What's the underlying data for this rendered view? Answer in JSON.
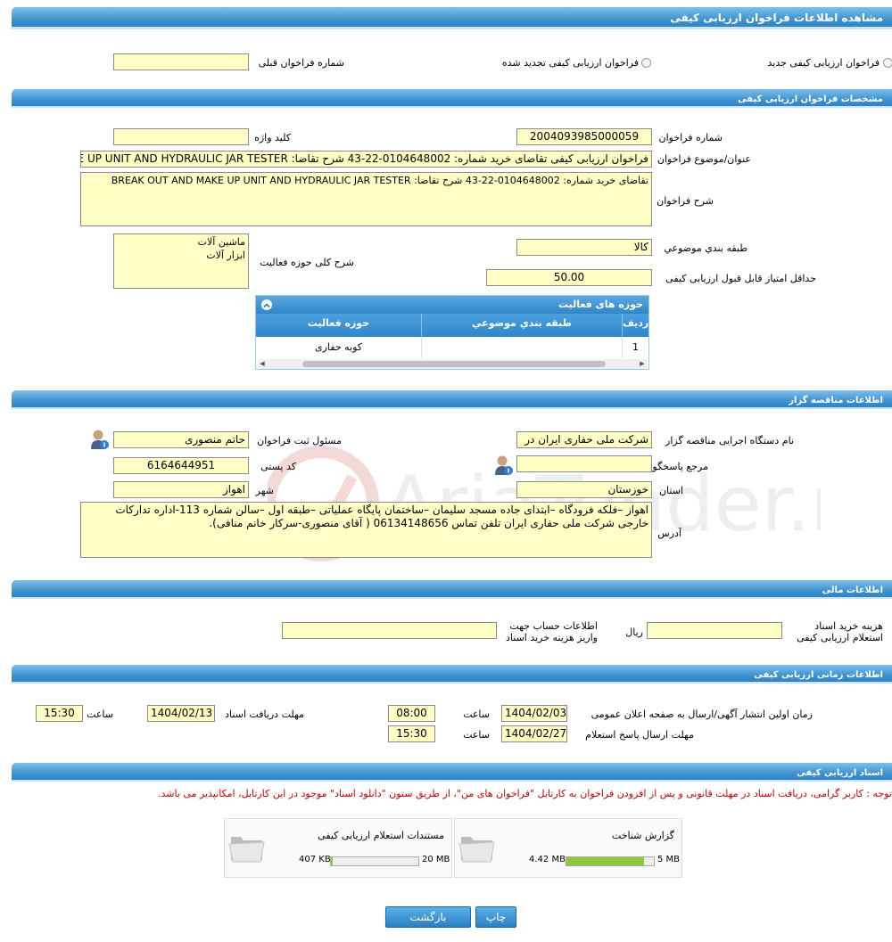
{
  "page_title": "مشاهده اطلاعات فراخوان ارزیابی کیفی",
  "type_options": {
    "new_label": "فراخوان ارزیابی کیفی جدید",
    "renewed_label": "فراخوان ارزیابی کیفی تجدید شده",
    "prev_number_label": "شماره فراخوان قبلی",
    "prev_number_value": ""
  },
  "specs": {
    "header": "مشخصات فراخوان ارزیابی کیفی",
    "call_number_label": "شماره فراخوان",
    "call_number_value": "2004093985000059",
    "keyword_label": "کلید واژه",
    "keyword_value": "",
    "subject_label": "عنوان/موضوع فراخوان",
    "subject_value": "فراخوان ارزیابی کیفی تقاضای خرید شماره:  0104648002-22-43 شرح تقاضا: BREAK OUT AND MAKE UP UNIT AND HYDRAULIC JAR TESTER",
    "description_label": "شرح فراخوان",
    "description_value": "تقاضای خرید شماره:  0104648002-22-43 شرح تقاضا: BREAK OUT AND MAKE UP UNIT AND HYDRAULIC JAR TESTER",
    "category_label": "طبقه بندي موضوعي",
    "category_value": "کالا",
    "activity_label": "شرح کلی حوزه فعالیت",
    "activity_lines": [
      "ماشین آلات",
      "ابزار آلات"
    ],
    "min_score_label": "حداقل امتیاز قابل قبول ارزیابی کیفی",
    "min_score_value": "50.00"
  },
  "activity_grid": {
    "title": "حوزه های فعالیت",
    "columns": [
      "ردیف",
      "طبقه بندي موضوعي",
      "حوزه فعالیت"
    ],
    "rows": [
      [
        "1",
        "",
        "کوبه حفاری"
      ]
    ]
  },
  "organizer": {
    "header": "اطلاعات مناقصه گزار",
    "org_name_label": "نام دستگاه اجرایی مناقصه گزار",
    "org_name_value": "شرکت ملی حفاری ایران در",
    "registrar_label": "مسئول ثبت فراخوان",
    "registrar_value": "حاتم منصوری",
    "responder_label": "مرجع پاسخگویی",
    "responder_value": "",
    "postal_label": "کد پستی",
    "postal_value": "6164644951",
    "province_label": "استان",
    "province_value": "خوزستان",
    "city_label": "شهر",
    "city_value": "اهواز",
    "address_label": "آدرس",
    "address_value": "اهواز –فلکه فرودگاه –ابتدای جاده مسجد سلیمان –ساختمان پایگاه عملیاتی –طبقه اول –سالن شماره 113-اداره تدارکات خارجی شرکت ملی حفاری ایران تلفن تماس  06134148656 ( آقای منصوری-سرکار خانم منافی)."
  },
  "financial": {
    "header": "اطلاعات مالی",
    "fee_label_line1": "هزینه خرید اسناد",
    "fee_label_line2": "استعلام ارزیابی کیفی",
    "fee_value": "",
    "currency": "ریال",
    "account_label_line1": "اطلاعات حساب جهت",
    "account_label_line2": "واریز هزینه خرید اسناد",
    "account_value": ""
  },
  "timing": {
    "header": "اطلاعات زمانی ارزیابی کیفی",
    "publish_label": "زمان اولین انتشار آگهی/ارسال به صفحه اعلان عمومی",
    "publish_date": "1404/02/03",
    "publish_time": "08:00",
    "receive_label": "مهلت دریافت اسناد",
    "receive_date": "1404/02/13",
    "receive_time": "15:30",
    "reply_label": "مهلت ارسال پاسخ استعلام",
    "reply_date": "1404/02/27",
    "reply_time": "15:30",
    "time_label": "ساعت"
  },
  "documents": {
    "header": "اسناد ارزیابی کیفی",
    "note": "توجه : کاربر گرامی، دریافت اسناد در مهلت قانونی و پس از افزودن فراخوان به کارتابل \"فراخوان های من\"، از طریق ستون \"دانلود اسناد\" موجود در این کارتابل، امکانپذیر می باشد.",
    "items": [
      {
        "title": "گزارش شناخت",
        "size": "4.42 MB",
        "max": "5 MB",
        "fraction": 0.884
      },
      {
        "title": "مستندات استعلام ارزیابی کیفی",
        "size": "407 KB",
        "max": "20 MB",
        "fraction": 0.02
      }
    ]
  },
  "buttons": {
    "print": "چاپ",
    "back": "بازگشت"
  },
  "watermark_text": "AriaTender.neT",
  "colors": {
    "header_blue": "#3f93d0",
    "field_yellow": "#ffffc6",
    "note_red": "#cc0000",
    "progress_green": "#8fc93a"
  }
}
